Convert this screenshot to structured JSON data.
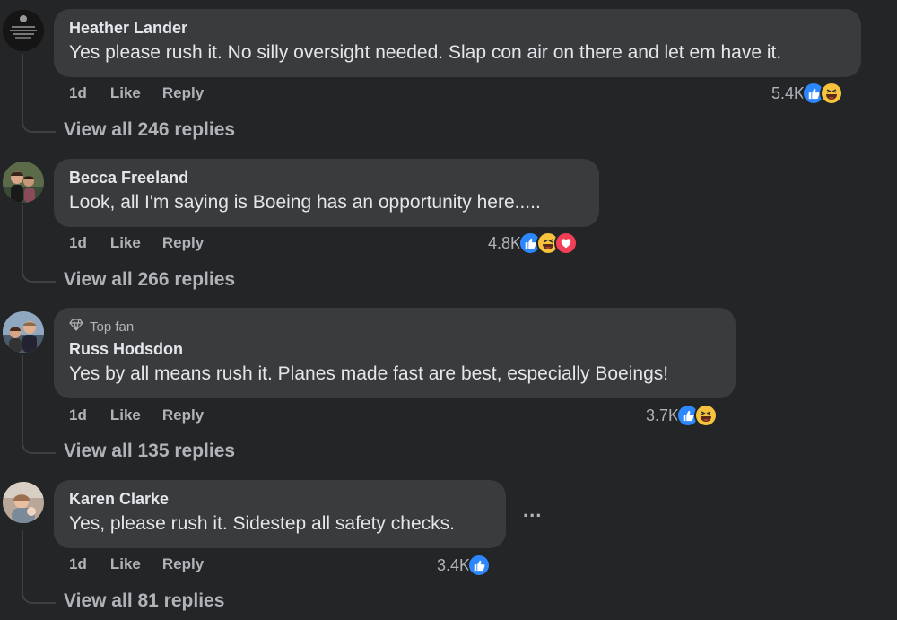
{
  "comments": [
    {
      "author": "Heather Lander",
      "text": "Yes please rush it. No silly oversight needed. Slap con air on there and let em have it.",
      "age": "1d",
      "like_label": "Like",
      "reply_label": "Reply",
      "reaction_count": "5.4K",
      "reactions": [
        "like-icon",
        "haha-icon"
      ],
      "view_replies": "View all 246 replies"
    },
    {
      "author": "Becca Freeland",
      "text": "Look, all I'm saying is Boeing has an opportunity here.....",
      "age": "1d",
      "like_label": "Like",
      "reply_label": "Reply",
      "reaction_count": "4.8K",
      "reactions": [
        "like-icon",
        "haha-icon",
        "love-icon"
      ],
      "view_replies": "View all 266 replies"
    },
    {
      "badge": "Top fan",
      "author": "Russ Hodsdon",
      "text": "Yes by all means rush it. Planes made fast are best, especially Boeings!",
      "age": "1d",
      "like_label": "Like",
      "reply_label": "Reply",
      "reaction_count": "3.7K",
      "reactions": [
        "like-icon",
        "haha-icon"
      ],
      "view_replies": "View all 135 replies"
    },
    {
      "author": "Karen Clarke",
      "text": "Yes, please rush it. Sidestep all safety checks.",
      "age": "1d",
      "like_label": "Like",
      "reply_label": "Reply",
      "reaction_count": "3.4K",
      "reactions": [
        "like-icon"
      ],
      "view_replies": "View all 81 replies",
      "more_label": "..."
    }
  ],
  "colors": {
    "background": "#242527",
    "bubble": "#3a3b3c",
    "like": "#2d88ff",
    "haha": "#f7c33c",
    "love": "#f33e58"
  }
}
